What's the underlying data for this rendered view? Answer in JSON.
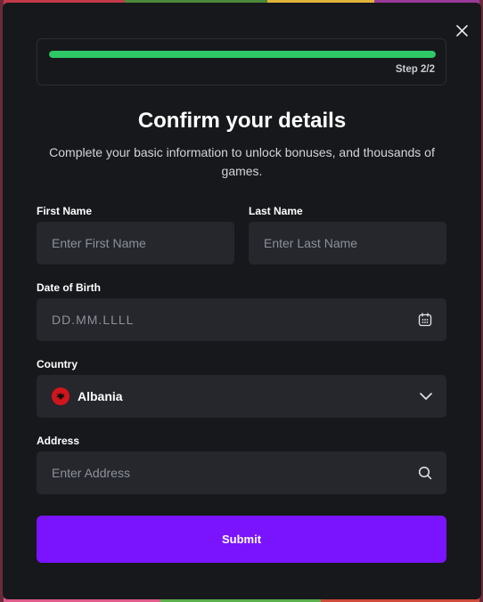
{
  "progress": {
    "step_label": "Step 2/2",
    "fraction": 1.0
  },
  "header": {
    "title": "Confirm your details",
    "subtitle": "Complete your basic information to unlock bonuses, and thousands of games."
  },
  "form": {
    "first_name": {
      "label": "First Name",
      "placeholder": "Enter First Name"
    },
    "last_name": {
      "label": "Last Name",
      "placeholder": "Enter Last Name"
    },
    "dob": {
      "label": "Date of Birth",
      "placeholder": "DD.MM.LLLL",
      "icon": "calendar-icon"
    },
    "country": {
      "label": "Country",
      "value": "Albania",
      "icon": "chevron-down-icon"
    },
    "address": {
      "label": "Address",
      "placeholder": "Enter Address",
      "icon": "search-icon"
    },
    "submit_label": "Submit"
  },
  "colors": {
    "accent": "#7a14ff",
    "progress": "#2ec866",
    "field_bg": "#25272d",
    "modal_bg": "#17181c"
  }
}
